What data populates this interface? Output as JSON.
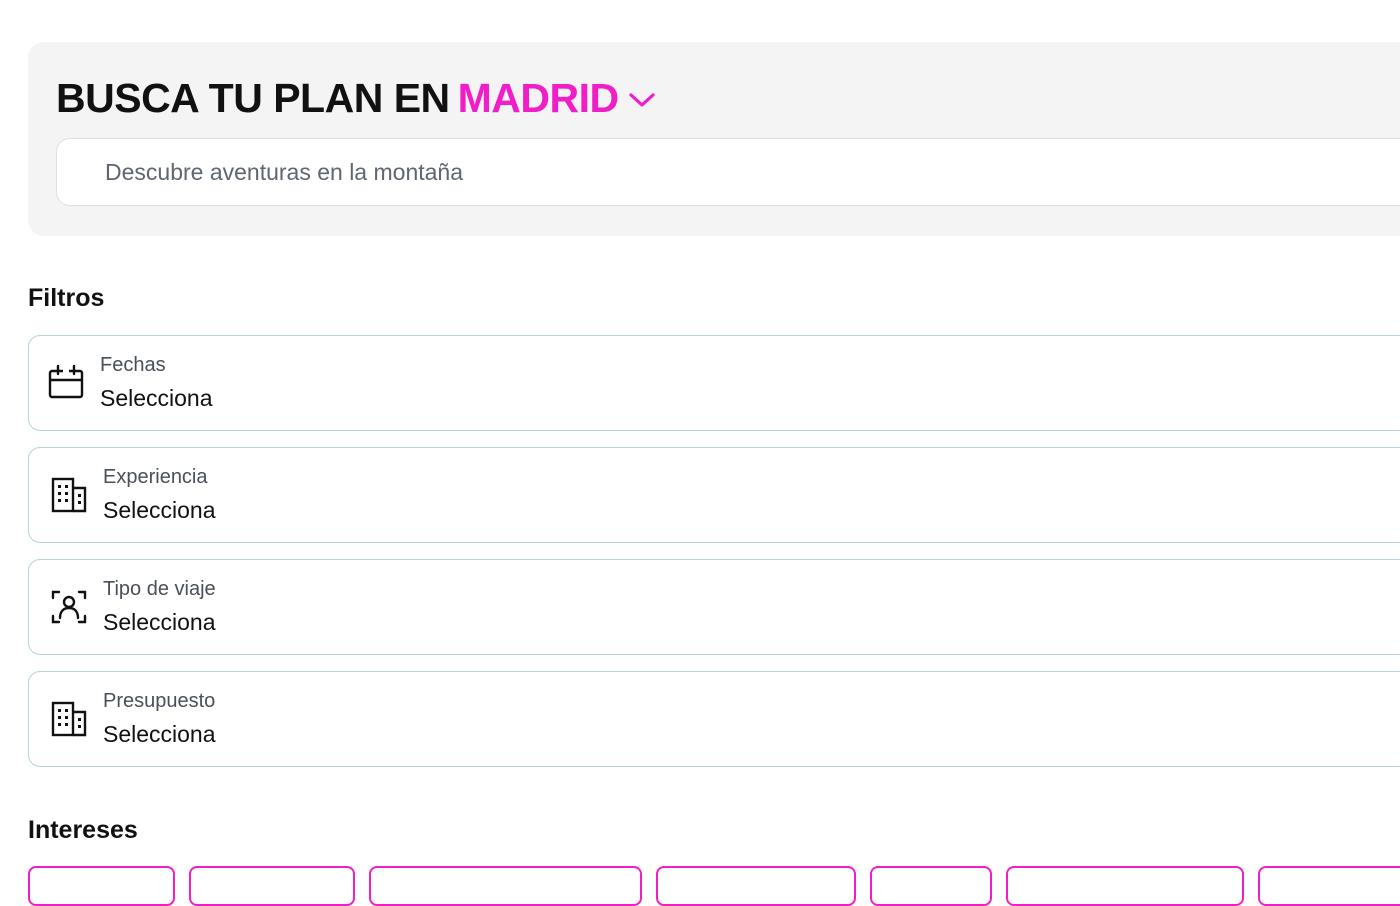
{
  "header": {
    "title_prefix": "BUSCA TU PLAN EN",
    "city": "MADRID",
    "city_color": "#f01ec8",
    "city_dropdown_icon": "chevron-down-icon"
  },
  "search": {
    "placeholder": "Descubre aventuras en la montaña",
    "value": ""
  },
  "filters": {
    "title": "Filtros",
    "items": [
      {
        "label": "Fechas",
        "value": "Selecciona",
        "icon": "calendar-icon"
      },
      {
        "label": "Experiencia",
        "value": "Selecciona",
        "icon": "building-icon"
      },
      {
        "label": "Tipo de viaje",
        "value": "Selecciona",
        "icon": "person-scan-icon"
      },
      {
        "label": "Presupuesto",
        "value": "Selecciona",
        "icon": "building-icon"
      }
    ]
  },
  "interests": {
    "title": "Intereses",
    "chip_border_color": "#f01ec8"
  }
}
